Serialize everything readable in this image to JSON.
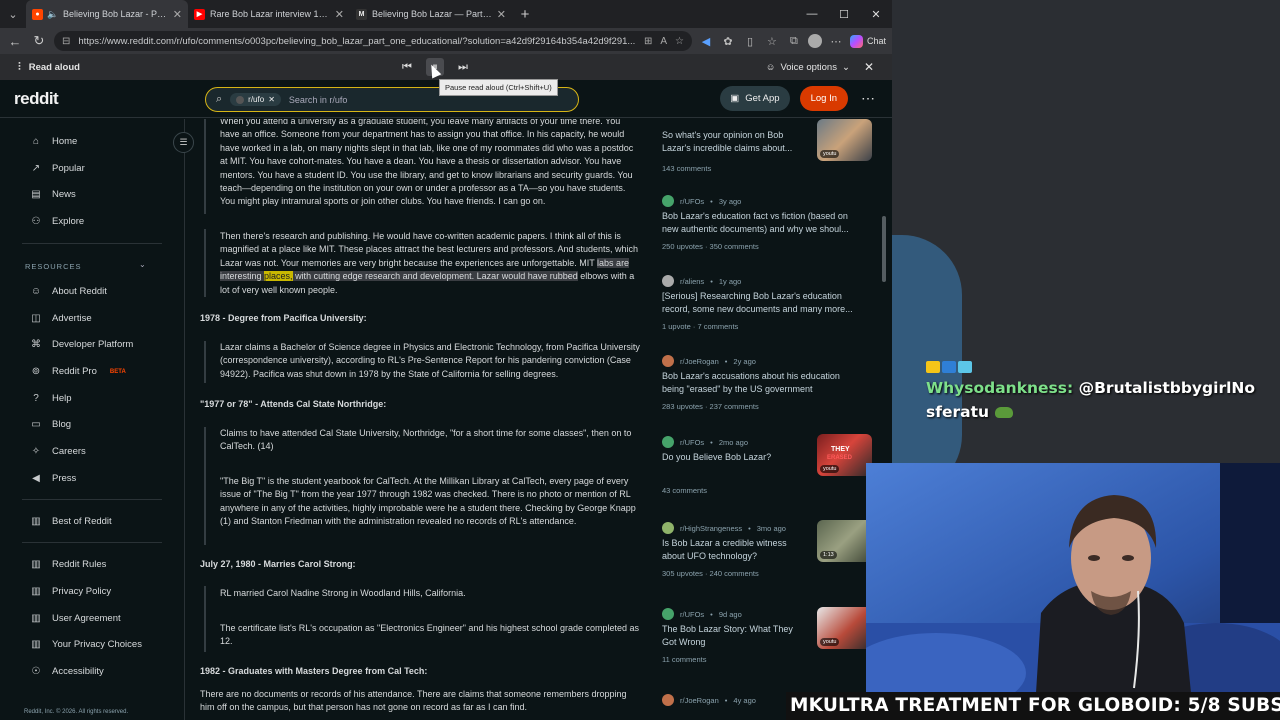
{
  "browser": {
    "tabs": [
      {
        "title": "Believing Bob Lazar - Part One",
        "active": true
      },
      {
        "title": "Rare Bob Lazar interview 1991 - Yo",
        "active": false
      },
      {
        "title": "Believing Bob Lazar — Part II — A",
        "active": false
      }
    ],
    "url": "https://www.reddit.com/r/ufo/comments/o003pc/believing_bob_lazar_part_one_educational/?solution=a42d9f29164b354a42d9f291...",
    "copilot_label": "Chat",
    "read_aloud": {
      "label": "Read aloud",
      "voice_options": "Voice options",
      "tooltip": "Pause read aloud (Ctrl+Shift+U)"
    }
  },
  "reddit_header": {
    "logo": "reddit",
    "community_chip": "r/ufo",
    "search_placeholder": "Search in r/ufo",
    "get_app": "Get App",
    "login": "Log In"
  },
  "left_nav": {
    "main": [
      "Home",
      "Popular",
      "News",
      "Explore"
    ],
    "resources_title": "RESOURCES",
    "resources": [
      "About Reddit",
      "Advertise",
      "Developer Platform",
      "Reddit Pro",
      "Help",
      "Blog",
      "Careers",
      "Press"
    ],
    "reddit_pro_badge": "BETA",
    "best_of": "Best of Reddit",
    "legal": [
      "Reddit Rules",
      "Privacy Policy",
      "User Agreement",
      "Your Privacy Choices",
      "Accessibility"
    ],
    "copyright": "Reddit, Inc. © 2026. All rights reserved."
  },
  "article": {
    "p1": "When you attend a university as a graduate student, you leave many artifacts of your time there. You have an office. Someone from your department has to assign you that office. In his capacity, he would have worked in a lab, on many nights slept in that lab, like one of my roommates did who was a postdoc at MIT. You have cohort-mates. You have a dean. You have a thesis or dissertation advisor. You have mentors. You have a student ID. You use the library, and get to know librarians and security guards. You teach—depending on the institution on your own or under a professor as a TA—so you have students. You might play intramural sports or join other clubs. You have friends. I can go on.",
    "p2_a": "Then there's research and publishing. He would have co-written academic papers. I think all of this is magnified at a place like MIT. These places attract the best lecturers and professors. And students, which Lazar was not. Your memories are very bright because the experiences are unforgettable. MIT ",
    "p2_hl1": "labs are interesting ",
    "p2_hlw": "places,",
    "p2_hl2": " with cutting edge research and development. Lazar would have rubbed",
    "p2_b": " elbows with a lot of very well known people.",
    "h1": "1978 - Degree from Pacifica University:",
    "p3": "Lazar claims a Bachelor of Science degree in Physics and Electronic Technology, from Pacifica University (correspondence university), according to RL's Pre-Sentence Report for his pandering conviction (Case 94922). Pacifica was shut down in 1978 by the State of California for selling degrees.",
    "h2": "\"1977 or 78\" - Attends Cal State Northridge:",
    "p4": "Claims to have attended Cal State University, Northridge, \"for a short time for some classes\", then on to CalTech. (14)",
    "p5": "\"The Big T\" is the student yearbook for CalTech. At the Millikan Library at CalTech, every page of every issue of \"The Big T\" from the year 1977 through 1982 was checked. There is no photo or mention of RL anywhere in any of the activities, highly improbable were he a student there. Checking by George Knapp (1) and Stanton Friedman with the administration revealed no records of RL's attendance.",
    "h3": "July 27, 1980 - Marries Carol Strong:",
    "p6": "RL married Carol Nadine Strong in Woodland Hills, California.",
    "p7": "The certificate list's RL's occupation as \"Electronics Engineer\" and his highest school grade completed as 12.",
    "h4": "1982 - Graduates with Masters Degree from Cal Tech:",
    "p8": "There are no documents or records of his attendance. There are claims that someone remembers dropping him off on the campus, but that person has not gone on record as far as I can find."
  },
  "related": [
    {
      "sub": "",
      "age": "",
      "title": "So what's your opinion on Bob Lazar's incredible claims about...",
      "stats": "143 comments",
      "thumb": true
    },
    {
      "sub": "r/UFOs",
      "age": "3y ago",
      "title": "Bob Lazar's education fact vs fiction (based on new authentic documents) and why we shoul...",
      "stats": "250 upvotes · 350 comments",
      "thumb": false
    },
    {
      "sub": "r/aliens",
      "age": "1y ago",
      "title": "[Serious] Researching Bob Lazar's education record, some new documents and many more...",
      "stats": "1 upvote · 7 comments",
      "thumb": false
    },
    {
      "sub": "r/JoeRogan",
      "age": "2y ago",
      "title": "Bob Lazar's accusations about his education being \"erased\" by the US government",
      "stats": "283 upvotes · 237 comments",
      "thumb": false
    },
    {
      "sub": "r/UFOs",
      "age": "2mo ago",
      "title": "Do you Believe Bob Lazar?",
      "stats": "43 comments",
      "thumb": true
    },
    {
      "sub": "r/HighStrangeness",
      "age": "3mo ago",
      "title": "Is Bob Lazar a credible witness about UFO technology?",
      "stats": "305 upvotes · 240 comments",
      "thumb": true
    },
    {
      "sub": "r/UFOs",
      "age": "9d ago",
      "title": "The Bob Lazar Story: What They Got Wrong",
      "stats": "11 comments",
      "thumb": true
    },
    {
      "sub": "r/JoeRogan",
      "age": "4y ago",
      "title": "",
      "stats": "",
      "thumb": false
    }
  ],
  "thumb_labels": {
    "yt": "youtu",
    "duration": "1:13",
    "they": "THEY",
    "erased": "ERASED"
  },
  "stream": {
    "chat_user": "Whysodankness:",
    "chat_message_a": " @BrutalistbbygirlNo",
    "chat_message_b": "sferatu",
    "ticker": "MKULTRA TREATMENT FOR GLOBOID: 5/8 SUBS"
  },
  "colors": {
    "accent": "#ff4500",
    "search_border": "#d7b516",
    "login": "#d93a00"
  }
}
